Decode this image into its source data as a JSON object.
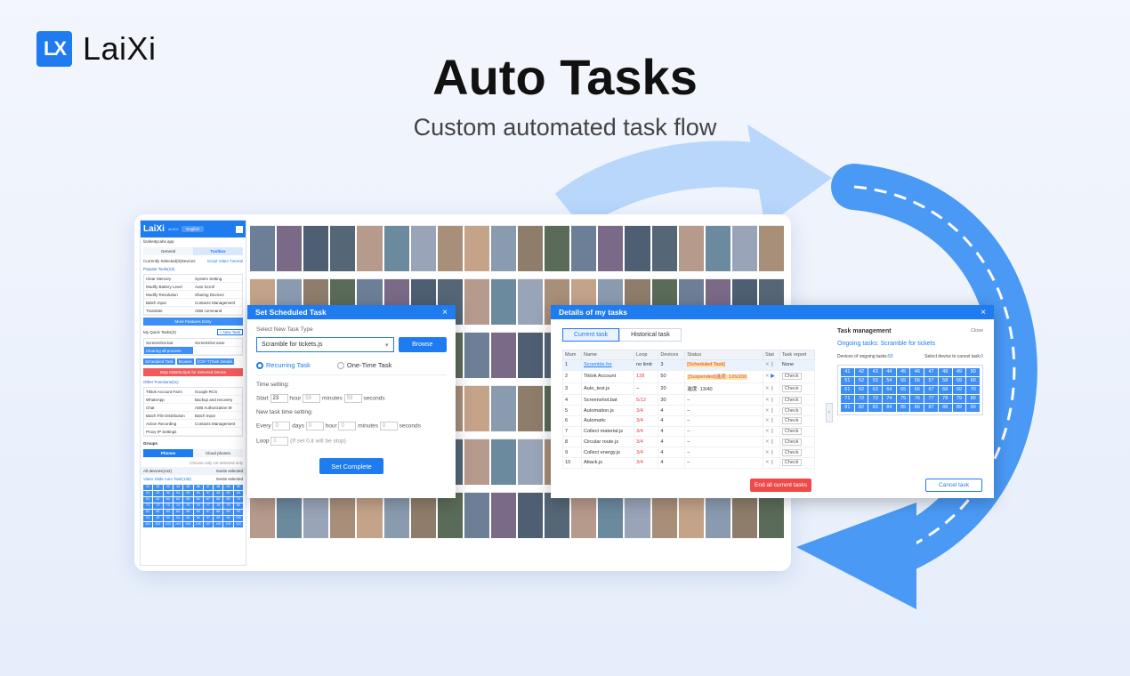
{
  "brand": {
    "logo_mark": "LX",
    "name": "LaiXi"
  },
  "hero": {
    "title": "Auto Tasks",
    "subtitle": "Custom automated task flow"
  },
  "sidebar": {
    "logo": "LaiXi",
    "version": "v4.12.0",
    "language": "English",
    "account": "lizaheitycahs.app",
    "tabs": [
      "General",
      "Toolbox"
    ],
    "selected_devices": "Currently Selected(0)Devices",
    "video_tutorial": "Script Video Tutorial",
    "popular_tools": "Popular Tools(13)",
    "tools": [
      "Clear Memory",
      "System Setting",
      "Modify Battery Level",
      "Auto Scroll",
      "Modify Resolution",
      "Sharing Devices",
      "Batch Input",
      "Contacts Management",
      "Translate",
      "ADB command"
    ],
    "more_features": "More Features Entry",
    "quick_tasks": "My Quick Tasks(3)",
    "new_task": "+ New Task",
    "quick_items": [
      "Screenshot.bat",
      "Screenshot save",
      "Clearing all process"
    ],
    "scheduled_tasks": "Scheduled Task",
    "browse": "Browse",
    "task_details": "(Ctrl+T)Task Details",
    "stop_scripts": "Stop ADB/Scripts for Selected Device",
    "other_functions": "Other Functions(11)",
    "other_items": [
      "Tiktok Account Farm",
      "Google RCS",
      "WhatsApp",
      "Backup and recovery",
      "Chat",
      "ADB Authorization M",
      "Batch File Distribution",
      "Batch Input",
      "Action Recording",
      "Contacts Management",
      "Proxy IP Settings"
    ],
    "groups": "Groups",
    "group_tabs": [
      "Phones",
      "Cloud phones"
    ],
    "filter": "Choose only   Un-selected only",
    "all_devices": "All devices(142)",
    "all_devices_sel": "0units selected",
    "group_row": "Video Slide Auto Task(138)",
    "group_row_sel": "0units selected",
    "minigrid": [
      "41",
      "42",
      "43",
      "44",
      "45",
      "46",
      "47",
      "48",
      "49",
      "50",
      "51",
      "52",
      "53",
      "54",
      "55",
      "56",
      "57",
      "58",
      "59",
      "60",
      "61",
      "62",
      "63",
      "64",
      "65",
      "66",
      "67",
      "68",
      "69",
      "70",
      "71",
      "72",
      "73",
      "74",
      "75",
      "76",
      "77",
      "78",
      "79",
      "80",
      "81",
      "82",
      "83",
      "84",
      "85",
      "86",
      "87",
      "88",
      "89",
      "90",
      "91",
      "92",
      "93",
      "94",
      "95",
      "96",
      "97",
      "98",
      "99",
      "100",
      "101",
      "102",
      "103",
      "104",
      "105",
      "106",
      "107",
      "108",
      "109",
      "110"
    ]
  },
  "schedule_dialog": {
    "title": "Set Scheduled Task",
    "close": "×",
    "select_label": "Select New Task Type",
    "selected_script": "Scramble for tickets.js",
    "browse": "Browse",
    "recurring": "Recurring Task",
    "one_time": "One-Time Task",
    "time_setting": "Time setting:",
    "start": "Start",
    "start_hour": "23",
    "hour": "hour",
    "start_min": "59",
    "minutes": "minutes",
    "start_sec": "59",
    "seconds": "seconds",
    "new_time": "New task time setting:",
    "every": "Every",
    "every_days": "0",
    "days": "days",
    "every_hour": "0",
    "every_min": "0",
    "every_sec": "0",
    "loop": "Loop",
    "loop_val": "1",
    "loop_hint": "(If set 0,it will be stop)",
    "submit": "Set Complete"
  },
  "details_dialog": {
    "title": "Details of my tasks",
    "close": "×",
    "tabs": [
      "Current task",
      "Historical task"
    ],
    "columns": [
      "Mum",
      "Name",
      "Loop",
      "Devices",
      "Status",
      "Stat",
      "Task report"
    ],
    "rows": [
      {
        "num": "1",
        "name": "Scramble.for",
        "loop": "no limit",
        "devices": "3",
        "status": "[Scheduled Task]",
        "report": "None"
      },
      {
        "num": "2",
        "name": "Tiktok Account",
        "loop": "128",
        "devices": "50",
        "status": "[Suspended]進度: 126/200",
        "report": "Check"
      },
      {
        "num": "3",
        "name": "Auto_test.js",
        "loop": "–",
        "devices": "20",
        "status": "進度: 13/40",
        "report": "Check"
      },
      {
        "num": "4",
        "name": "Screenshot.bat",
        "loop": "5/12",
        "devices": "30",
        "status": "–",
        "report": "Check"
      },
      {
        "num": "5",
        "name": "Automation.js",
        "loop": "3/4",
        "devices": "4",
        "status": "–",
        "report": "Check"
      },
      {
        "num": "6",
        "name": "Automatic",
        "loop": "3/4",
        "devices": "4",
        "status": "–",
        "report": "Check"
      },
      {
        "num": "7",
        "name": "Collect material.js",
        "loop": "3/4",
        "devices": "4",
        "status": "–",
        "report": "Check"
      },
      {
        "num": "8",
        "name": "Circular route.js",
        "loop": "3/4",
        "devices": "4",
        "status": "–",
        "report": "Check"
      },
      {
        "num": "9",
        "name": "Collect energy.js",
        "loop": "3/4",
        "devices": "4",
        "status": "–",
        "report": "Check"
      },
      {
        "num": "10",
        "name": "Attack.js",
        "loop": "3/4",
        "devices": "4",
        "status": "–",
        "report": "Check"
      }
    ],
    "end_all": "End all current tasks",
    "task_management": "Task management",
    "tm_close": "Close",
    "ongoing": "Ongoing tasks: Scramble for tickets",
    "ongoing_devices_label": "Devices of ongoing tasks:",
    "ongoing_devices": "50",
    "cancel_label": "Select device to cancel task:",
    "cancel_count": "0",
    "device_numbers": [
      "41",
      "42",
      "43",
      "44",
      "45",
      "46",
      "47",
      "48",
      "49",
      "50",
      "51",
      "52",
      "53",
      "54",
      "55",
      "56",
      "57",
      "58",
      "59",
      "60",
      "61",
      "62",
      "63",
      "64",
      "65",
      "66",
      "67",
      "68",
      "69",
      "70",
      "71",
      "72",
      "73",
      "74",
      "75",
      "76",
      "77",
      "78",
      "79",
      "80",
      "81",
      "82",
      "83",
      "84",
      "85",
      "86",
      "87",
      "88",
      "89",
      "90"
    ],
    "cancel_task": "Cancel task"
  },
  "colors": {
    "accent": "#1e7bf0",
    "danger": "#f04b4b",
    "arrow": "#4a9af5"
  }
}
